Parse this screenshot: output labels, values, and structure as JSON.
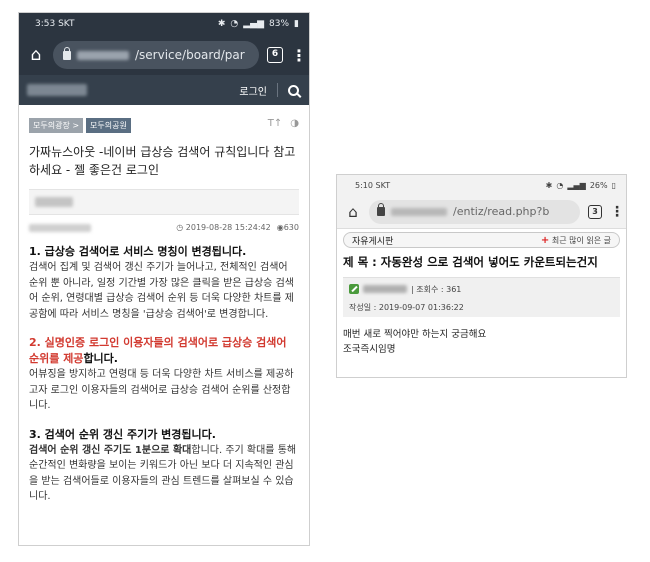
{
  "left": {
    "status": {
      "time": "3:53 SKT",
      "battery": "83%"
    },
    "url": "/service/board/par",
    "tab_count": "6",
    "nav": {
      "login": "로그인"
    },
    "crumbs": [
      "모두의광장 >",
      "모두의공원"
    ],
    "tools": [
      "T↑",
      "◑"
    ],
    "title": "가짜뉴스아웃 -네이버 급상승 검색어 규칙입니다 참고하세요 - 젤 좋은건 로그인",
    "date": "2019-08-28 15:24:42",
    "views": "630",
    "sections": [
      {
        "heading": "1. 급상승 검색어로 서비스 명칭이 변경됩니다.",
        "text": "검색어 집계 및 검색어 갱신 주기가 늘어나고, 전체적인 검색어 순위 뿐 아니라, 일정 기간별 가장 많은 클릭을 받은 급상승 검색어 순위, 연령대별 급상승 검색어 순위 등 더욱 다양한 차트를 제공함에 따라 서비스 명칭을 '급상승 검색어'로 변경합니다."
      },
      {
        "heading_red": "2. 실명인증 로그인 이용자들의 검색어로 급상승 검색어 순위를 제공",
        "heading_tail": "합니다.",
        "text": "어뷰징을 방지하고 연령대 등 더욱 다양한 차트 서비스를 제공하고자 로그인 이용자들의 검색어로 급상승 검색어 순위를 산정합니다."
      },
      {
        "heading": "3. 검색어 순위 갱신 주기가 변경됩니다.",
        "lead": "검색어 순위 갱신 주기도 1분으로 확대",
        "text": "합니다. 주기 확대를 통해 순간적인 변화량을 보이는 키워드가 아닌 보다 더 지속적인 관심을 받는 검색어들로 이용자들의 관심 트렌드를 살펴보실 수 있습니다."
      }
    ]
  },
  "right": {
    "status": {
      "time": "5:10 SKT",
      "battery": "26%"
    },
    "url": "/entiz/read.php?b",
    "tab_count": "3",
    "board": "자유게시판",
    "hot": "최근 많이 읽은 글",
    "title": "제 목 : 자동완성 으로 검색어 넣어도 카운트되는건지",
    "views": "| 조회수 : 361",
    "written": "작성일 : 2019-09-07 01:36:22",
    "body": [
      "매번 새로 찍어야만 하는지 궁금해요",
      "조국즉시임명"
    ]
  }
}
